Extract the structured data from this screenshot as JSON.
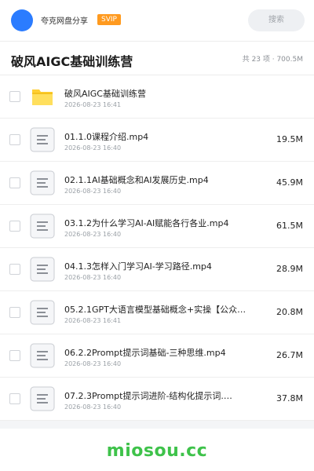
{
  "app": {
    "brand": "夸克网盘分享",
    "badge": "SVIP",
    "search_placeholder": "搜索"
  },
  "folder": {
    "title": "破风AIGC基础训练营",
    "count_text": "共 23 项 · 700.5M"
  },
  "items": [
    {
      "type": "folder",
      "name": "破风AIGC基础训练营",
      "date": "2026-08-23 16:41",
      "size": ""
    },
    {
      "type": "file",
      "name": "01.1.0课程介绍.mp4",
      "date": "2026-08-23 16:40",
      "size": "19.5M"
    },
    {
      "type": "file",
      "name": "02.1.1AI基础概念和AI发展历史.mp4",
      "date": "2026-08-23 16:40",
      "size": "45.9M"
    },
    {
      "type": "file",
      "name": "03.1.2为什么学习AI-AI赋能各行各业.mp4",
      "date": "2026-08-23 16:40",
      "size": "61.5M"
    },
    {
      "type": "file",
      "name": "04.1.3怎样入门学习AI-学习路径.mp4",
      "date": "2026-08-23 16:40",
      "size": "28.9M"
    },
    {
      "type": "file",
      "name": "05.2.1GPT大语言模型基础概念+实操【公众号…",
      "date": "2026-08-23 16:41",
      "size": "20.8M"
    },
    {
      "type": "file",
      "name": "06.2.2Prompt提示词基础-三种思维.mp4",
      "date": "2026-08-23 16:40",
      "size": "26.7M"
    },
    {
      "type": "file",
      "name": "07.2.3Prompt提示词进阶-结构化提示词.…",
      "date": "2026-08-23 16:40",
      "size": "37.8M"
    }
  ],
  "watermark": "miosou.cc",
  "colors": {
    "brand_blue": "#2b7cff",
    "svip_orange": "#ff9a1f",
    "folder_yellow": "#ffcf33",
    "watermark_green": "#3ec24a"
  },
  "icons": {
    "folder": "folder-icon",
    "file": "file-icon"
  }
}
